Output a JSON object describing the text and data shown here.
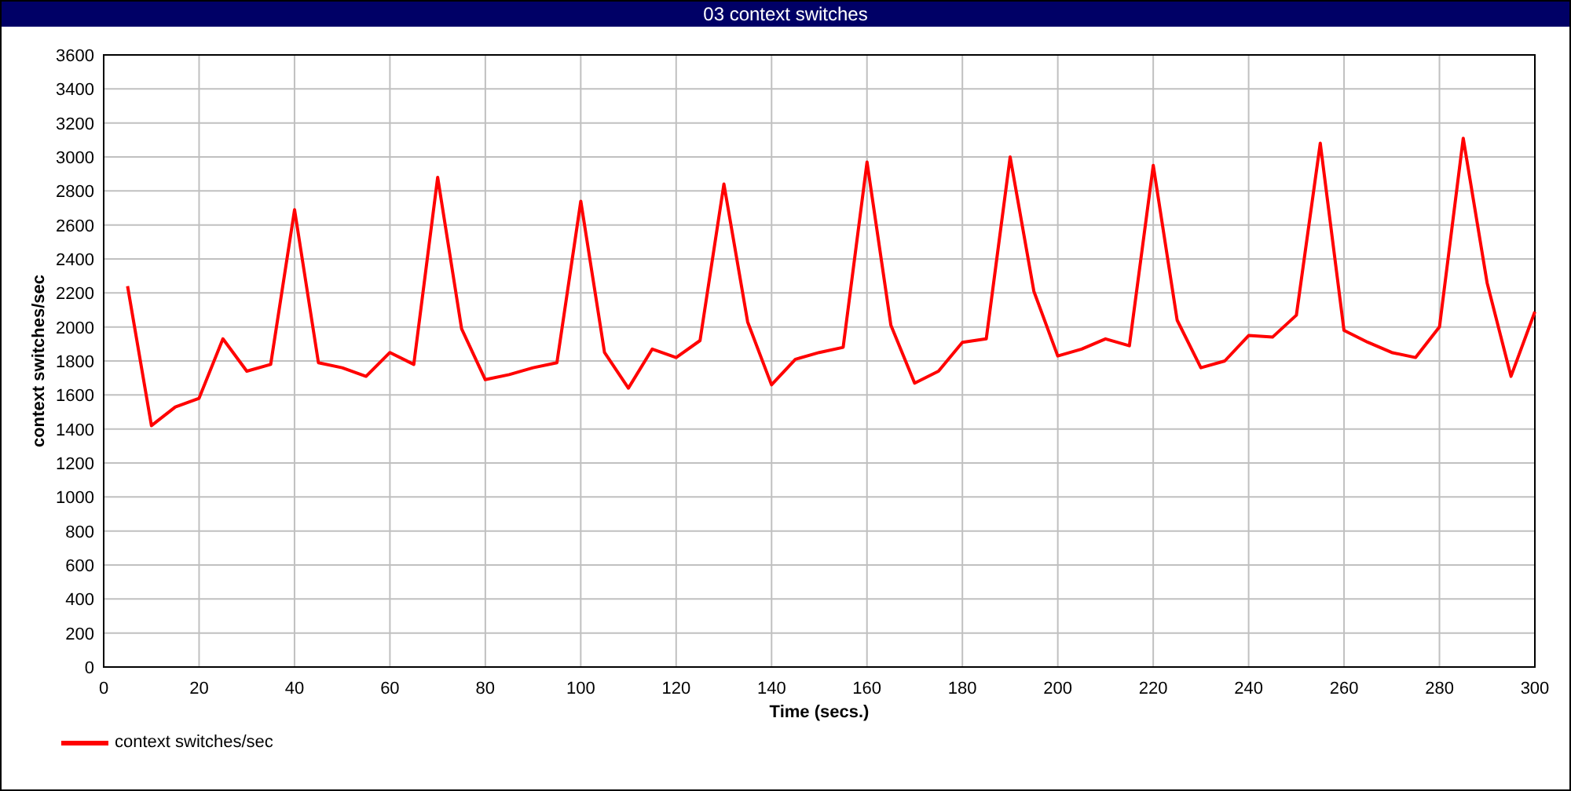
{
  "window": {
    "title": "03 context switches"
  },
  "chart": {
    "chart_data": {
      "type": "line",
      "grid": true,
      "xlabel": "Time (secs.)",
      "ylabel": "context switches/sec",
      "xlim": [
        0,
        300
      ],
      "ylim": [
        0,
        3600
      ],
      "xticks": [
        0,
        20,
        40,
        60,
        80,
        100,
        120,
        140,
        160,
        180,
        200,
        220,
        240,
        260,
        280,
        300
      ],
      "yticks": [
        0,
        200,
        400,
        600,
        800,
        1000,
        1200,
        1400,
        1600,
        1800,
        2000,
        2200,
        2400,
        2600,
        2800,
        3000,
        3200,
        3400,
        3600
      ],
      "x": [
        5,
        10,
        15,
        20,
        25,
        30,
        35,
        40,
        45,
        50,
        55,
        60,
        65,
        70,
        75,
        80,
        85,
        90,
        95,
        100,
        105,
        110,
        115,
        120,
        125,
        130,
        135,
        140,
        145,
        150,
        155,
        160,
        165,
        170,
        175,
        180,
        185,
        190,
        195,
        200,
        205,
        210,
        215,
        220,
        225,
        230,
        235,
        240,
        245,
        250,
        255,
        260,
        265,
        270,
        275,
        280,
        285,
        290,
        295,
        300
      ],
      "series": [
        {
          "name": "context switches/sec",
          "color": "#ff0000",
          "values": [
            2240,
            1420,
            1530,
            1580,
            1930,
            1740,
            1780,
            2690,
            1790,
            1760,
            1710,
            1850,
            1780,
            2880,
            1990,
            1690,
            1720,
            1760,
            1790,
            2740,
            1850,
            1640,
            1870,
            1820,
            1920,
            2840,
            2030,
            1660,
            1810,
            1850,
            1880,
            2970,
            2010,
            1670,
            1740,
            1910,
            1930,
            3000,
            2210,
            1830,
            1870,
            1930,
            1890,
            2950,
            2040,
            1760,
            1800,
            1950,
            1940,
            2070,
            3080,
            1980,
            1910,
            1850,
            1820,
            2000,
            3110,
            2260,
            1710,
            2090
          ]
        }
      ]
    }
  }
}
